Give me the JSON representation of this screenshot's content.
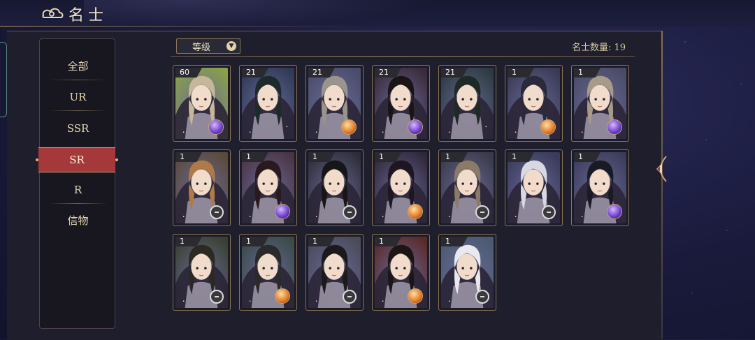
{
  "header": {
    "title": "名士",
    "icon": "cloud-swirl-icon"
  },
  "sidebar": {
    "items": [
      {
        "label": "全部",
        "active": false
      },
      {
        "label": "UR",
        "active": false
      },
      {
        "label": "SSR",
        "active": false
      },
      {
        "label": "SR",
        "active": true
      },
      {
        "label": "R",
        "active": false
      },
      {
        "label": "信物",
        "active": false
      }
    ]
  },
  "toolbar": {
    "sort_label": "等级",
    "count_label": "名士数量: 19"
  },
  "colors": {
    "accent_red": "#a4383a",
    "gold": "#b8955a",
    "bg": "#1b1c3e"
  },
  "cards": [
    {
      "level": "60",
      "hair": "#c7b79a",
      "bg": "#8aa04a",
      "badge": "purple-orb-icon"
    },
    {
      "level": "21",
      "hair": "#1d2a2a",
      "bg": "#2f3a55",
      "badge": "none"
    },
    {
      "level": "21",
      "hair": "#9a958a",
      "bg": "#4a4c6a",
      "badge": "orange-orb-icon"
    },
    {
      "level": "21",
      "hair": "#1a1414",
      "bg": "#3a2a3a",
      "badge": "purple-orb-icon"
    },
    {
      "level": "21",
      "hair": "#1e2a24",
      "bg": "#2c3a40",
      "badge": "none"
    },
    {
      "level": "1",
      "hair": "#2a2a3a",
      "bg": "#3a3a55",
      "badge": "orange-orb-icon"
    },
    {
      "level": "1",
      "hair": "#a89c88",
      "bg": "#4a4a66",
      "badge": "purple-orb-icon"
    },
    {
      "level": "1",
      "hair": "#b07a48",
      "bg": "#5a4a3a",
      "badge": "compass-icon"
    },
    {
      "level": "1",
      "hair": "#2a1a1e",
      "bg": "#4a3545",
      "badge": "purple-orb-icon"
    },
    {
      "level": "1",
      "hair": "#161616",
      "bg": "#2e2e3a",
      "badge": "compass-icon"
    },
    {
      "level": "1",
      "hair": "#1e1620",
      "bg": "#30283a",
      "badge": "orange-orb-icon"
    },
    {
      "level": "1",
      "hair": "#8a7a66",
      "bg": "#3a3a4a",
      "badge": "compass-icon"
    },
    {
      "level": "1",
      "hair": "#d8d8e0",
      "bg": "#3a3a5a",
      "badge": "compass-icon"
    },
    {
      "level": "1",
      "hair": "#1a1a24",
      "bg": "#3c3c5a",
      "badge": "purple-orb-icon"
    },
    {
      "level": "1",
      "hair": "#2a2a20",
      "bg": "#3a4030",
      "badge": "compass-icon"
    },
    {
      "level": "1",
      "hair": "#2a2a2a",
      "bg": "#3a4a48",
      "badge": "orange-orb-icon"
    },
    {
      "level": "1",
      "hair": "#1a1a1a",
      "bg": "#4a4a5a",
      "badge": "compass-icon"
    },
    {
      "level": "1",
      "hair": "#1a1616",
      "bg": "#5a2a2a",
      "badge": "orange-orb-icon"
    },
    {
      "level": "1",
      "hair": "#e8e8ee",
      "bg": "#4a5a70",
      "badge": "compass-icon"
    }
  ]
}
